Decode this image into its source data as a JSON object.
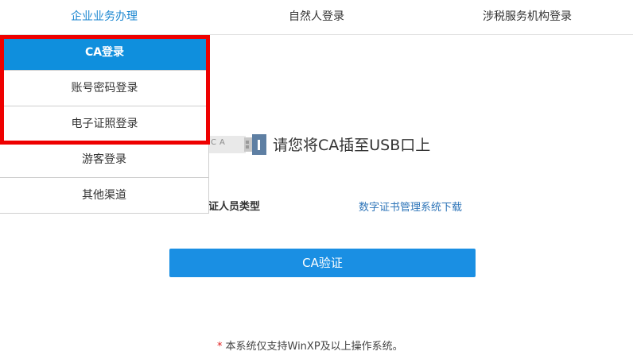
{
  "tabs": [
    {
      "label": "企业业务办理",
      "active": true
    },
    {
      "label": "自然人登录",
      "active": false
    },
    {
      "label": "涉税服务机构登录",
      "active": false
    }
  ],
  "menu": {
    "items": [
      {
        "label": "CA登录",
        "active": true
      },
      {
        "label": "账号密码登录",
        "active": false
      },
      {
        "label": "电子证照登录",
        "active": false
      },
      {
        "label": "游客登录",
        "active": false
      },
      {
        "label": "其他渠道",
        "active": false
      }
    ]
  },
  "usb": {
    "icon": "usb-key-icon",
    "label": "CA",
    "prompt": "请您将CA插至USB口上"
  },
  "cert": {
    "type_label": "证人员类型",
    "download_link": "数字证书管理系统下载"
  },
  "verify_button": "CA验证",
  "footer": {
    "star": "*",
    "note": "本系统仅支持WinXP及以上操作系统。"
  },
  "colors": {
    "accent": "#1a86d0",
    "menu_active": "#0f8fdd",
    "button": "#1a8fe3",
    "highlight": "#ee0000",
    "link": "#2d74b8"
  }
}
